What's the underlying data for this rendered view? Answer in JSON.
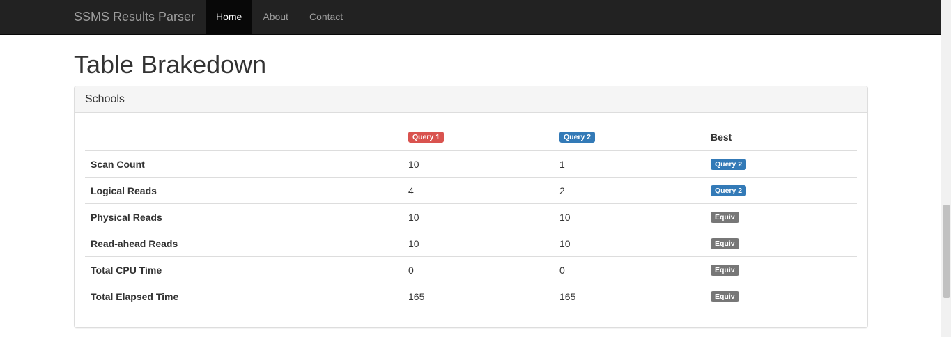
{
  "navbar": {
    "brand": "SSMS Results Parser",
    "items": [
      {
        "label": "Home",
        "active": true
      },
      {
        "label": "About",
        "active": false
      },
      {
        "label": "Contact",
        "active": false
      }
    ]
  },
  "page": {
    "title": "Table Brakedown"
  },
  "panel": {
    "heading": "Schools",
    "table": {
      "headers": {
        "metric": "",
        "query1": "Query 1",
        "query2": "Query 2",
        "best": "Best"
      },
      "rows": [
        {
          "metric": "Scan Count",
          "q1": "10",
          "q2": "1",
          "best": "Query 2",
          "best_type": "primary"
        },
        {
          "metric": "Logical Reads",
          "q1": "4",
          "q2": "2",
          "best": "Query 2",
          "best_type": "primary"
        },
        {
          "metric": "Physical Reads",
          "q1": "10",
          "q2": "10",
          "best": "Equiv",
          "best_type": "default"
        },
        {
          "metric": "Read-ahead Reads",
          "q1": "10",
          "q2": "10",
          "best": "Equiv",
          "best_type": "default"
        },
        {
          "metric": "Total CPU Time",
          "q1": "0",
          "q2": "0",
          "best": "Equiv",
          "best_type": "default"
        },
        {
          "metric": "Total Elapsed Time",
          "q1": "165",
          "q2": "165",
          "best": "Equiv",
          "best_type": "default"
        }
      ]
    }
  },
  "colors": {
    "navbar_bg": "#222222",
    "query1_label": "#d9534f",
    "query2_label": "#337ab7",
    "equiv_label": "#777777"
  }
}
